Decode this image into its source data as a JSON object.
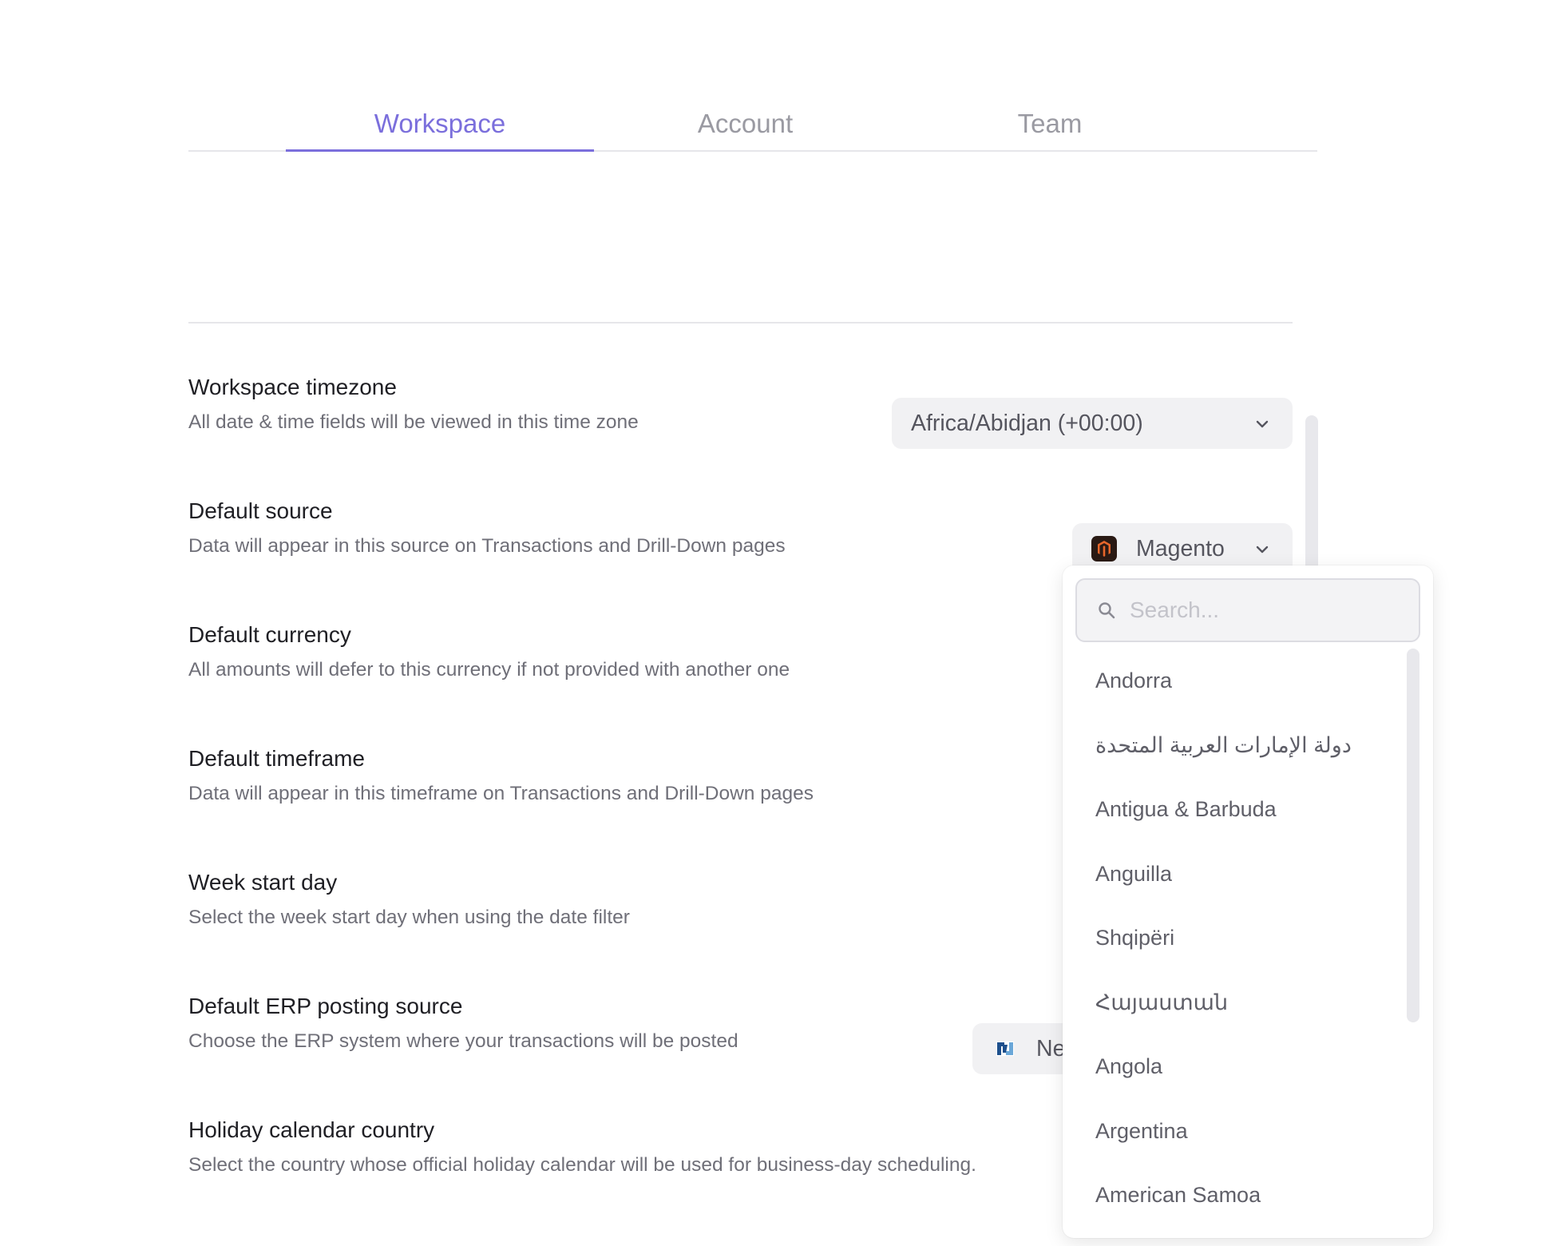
{
  "tabs": [
    {
      "label": "Workspace",
      "active": true
    },
    {
      "label": "Account",
      "active": false
    },
    {
      "label": "Team",
      "active": false
    }
  ],
  "settings": [
    {
      "title": "Workspace timezone",
      "desc": "All date & time fields will be viewed in this time zone"
    },
    {
      "title": "Default source",
      "desc": "Data will appear in this source on Transactions and Drill-Down pages"
    },
    {
      "title": "Default currency",
      "desc": "All amounts will defer to this currency if not provided with another one"
    },
    {
      "title": "Default timeframe",
      "desc": "Data will appear in this timeframe on Transactions and Drill-Down pages"
    },
    {
      "title": "Week start day",
      "desc": "Select the week start day when using the date filter"
    },
    {
      "title": "Default ERP posting source",
      "desc": "Choose the ERP system where your transactions will be posted"
    },
    {
      "title": "Holiday calendar country",
      "desc": "Select the country whose official holiday calendar will be used for business-day scheduling."
    }
  ],
  "controls": {
    "timezone_value": "Africa/Abidjan (+00:00)",
    "source_value": "Magento",
    "erp_value_visible": "Ne"
  },
  "dropdown": {
    "search_placeholder": "Search...",
    "options": [
      "Andorra",
      "دولة الإمارات العربية المتحدة",
      "Antigua & Barbuda",
      "Anguilla",
      "Shqipëri",
      "Հայաստան",
      "Angola",
      "Argentina",
      "American Samoa"
    ]
  },
  "colors": {
    "accent": "#7b6fdc",
    "muted_text": "#6f6f78",
    "control_bg": "#f1f1f3"
  }
}
